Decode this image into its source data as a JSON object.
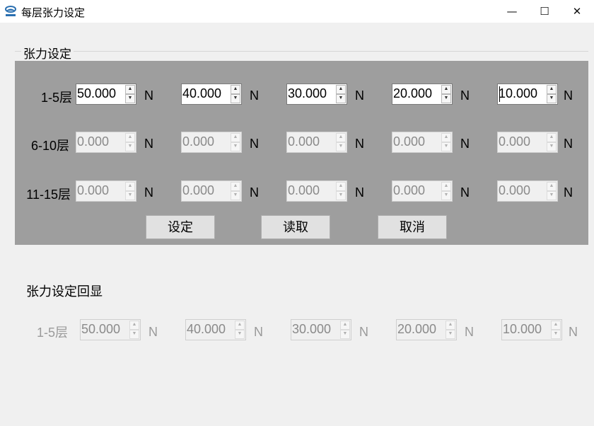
{
  "window": {
    "title": "每层张力设定",
    "minimize_glyph": "—",
    "maximize_glyph": "☐",
    "close_glyph": "✕"
  },
  "group": {
    "title": "张力设定"
  },
  "rows": [
    {
      "label": "1-5层",
      "values": [
        "50.000",
        "40.000",
        "30.000",
        "20.000",
        "10.000"
      ],
      "enabled": true
    },
    {
      "label": "6-10层",
      "values": [
        "0.000",
        "0.000",
        "0.000",
        "0.000",
        "0.000"
      ],
      "enabled": false
    },
    {
      "label": "11-15层",
      "values": [
        "0.000",
        "0.000",
        "0.000",
        "0.000",
        "0.000"
      ],
      "enabled": false
    }
  ],
  "unit": "N",
  "buttons": {
    "set": "设定",
    "read": "读取",
    "cancel": "取消"
  },
  "echo": {
    "title": "张力设定回显",
    "label": "1-5层",
    "values": [
      "50.000",
      "40.000",
      "30.000",
      "20.000",
      "10.000"
    ]
  },
  "spin_arrows": {
    "up": "▲",
    "down": "▼"
  },
  "colors": {
    "panel": "#9e9e9e",
    "window_bg": "#f0f0f0",
    "titlebar": "#ffffff"
  }
}
